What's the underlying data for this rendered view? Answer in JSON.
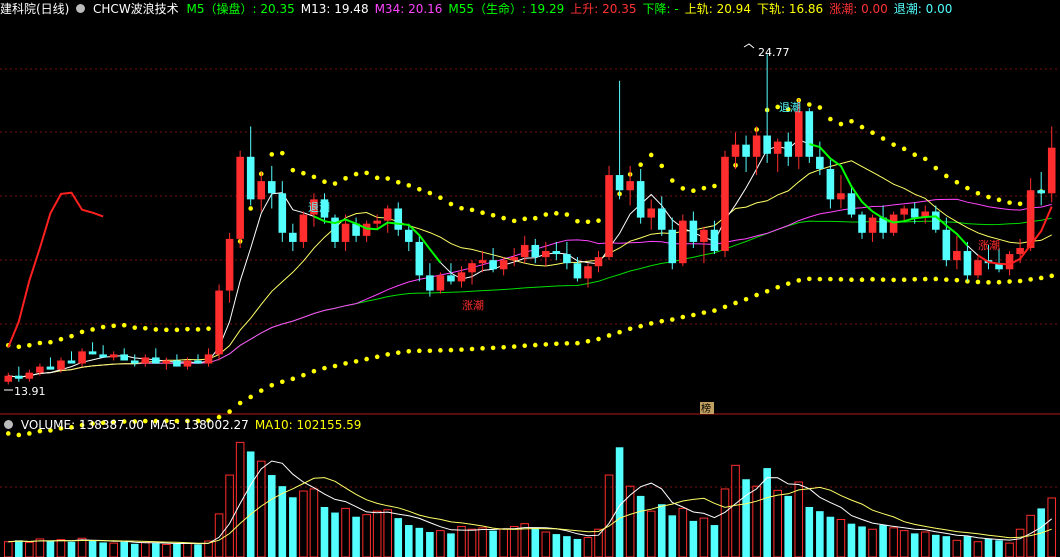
{
  "colors": {
    "up": "#ff2d2d",
    "down": "#54ffff",
    "green_line": "#00ff00",
    "ma5": "#ffffff",
    "ma13": "#ffff66",
    "ma34": "#ff44ff",
    "ma55": "#00dd00",
    "band": "#ffff00",
    "label": "#ffffff"
  },
  "header": {
    "title": "建科院(日线)",
    "indicator": "CHCW波浪技术",
    "items": [
      {
        "label": "M5（操盘）",
        "value": "20.35",
        "color": "#00ff00"
      },
      {
        "label": "M13",
        "value": "19.48",
        "color": "#ffffff"
      },
      {
        "label": "M34",
        "value": "20.16",
        "color": "#ff44ff"
      },
      {
        "label": "M55（生命）",
        "value": "19.29",
        "color": "#00ff00"
      },
      {
        "label": "上升",
        "value": "20.35",
        "color": "#ff3333"
      },
      {
        "label": "下降",
        "value": "-",
        "color": "#00ff00"
      },
      {
        "label": "上轨",
        "value": "20.94",
        "color": "#ffff00"
      },
      {
        "label": "下轨",
        "value": "16.86",
        "color": "#ffff00"
      },
      {
        "label": "涨潮",
        "value": "0.00",
        "color": "#ff3333"
      },
      {
        "label": "退潮",
        "value": "0.00",
        "color": "#54ffff"
      }
    ]
  },
  "volume_header": {
    "items": [
      {
        "label": "VOLUME",
        "value": "138387.00",
        "color": "#ffffff"
      },
      {
        "label": "MA5",
        "value": "138002.27",
        "color": "#ffffff"
      },
      {
        "label": "MA10",
        "value": "102155.59",
        "color": "#ffff00"
      }
    ]
  },
  "annotations": {
    "high_label": "24.77",
    "low_label": "13.91",
    "rise_label_1": "涨潮",
    "rise_label_2": "涨潮",
    "ebb_label_1": "退潮",
    "ebb_label_2": "退潮",
    "badge": "榜"
  },
  "chart_data": {
    "type": "candlestick",
    "price_range": [
      13.4,
      25.9
    ],
    "volume_range": [
      0,
      180000
    ],
    "candles": [
      [
        14.0,
        14.3,
        13.91,
        14.2
      ],
      [
        14.2,
        14.5,
        14.0,
        14.1
      ],
      [
        14.1,
        14.4,
        14.0,
        14.3
      ],
      [
        14.3,
        14.6,
        14.2,
        14.5
      ],
      [
        14.5,
        14.8,
        14.4,
        14.4
      ],
      [
        14.4,
        14.8,
        14.3,
        14.7
      ],
      [
        14.7,
        15.0,
        14.6,
        14.6
      ],
      [
        14.6,
        15.1,
        14.5,
        15.0
      ],
      [
        15.0,
        15.3,
        14.9,
        14.9
      ],
      [
        14.9,
        15.2,
        14.8,
        14.8
      ],
      [
        14.8,
        15.0,
        14.7,
        14.9
      ],
      [
        14.9,
        15.1,
        14.8,
        14.7
      ],
      [
        14.7,
        14.9,
        14.5,
        14.6
      ],
      [
        14.6,
        14.9,
        14.5,
        14.8
      ],
      [
        14.8,
        15.1,
        14.7,
        14.6
      ],
      [
        14.6,
        14.8,
        14.4,
        14.7
      ],
      [
        14.7,
        14.9,
        14.5,
        14.5
      ],
      [
        14.5,
        14.8,
        14.4,
        14.7
      ],
      [
        14.7,
        14.9,
        14.6,
        14.6
      ],
      [
        14.6,
        15.1,
        14.5,
        14.9
      ],
      [
        14.9,
        17.2,
        14.7,
        17.0
      ],
      [
        17.0,
        18.9,
        16.6,
        18.7
      ],
      [
        18.7,
        21.6,
        18.4,
        21.4
      ],
      [
        21.4,
        22.4,
        19.8,
        20.0
      ],
      [
        20.0,
        20.9,
        19.6,
        20.6
      ],
      [
        20.6,
        21.1,
        19.7,
        20.2
      ],
      [
        20.2,
        20.6,
        18.6,
        18.9
      ],
      [
        18.9,
        19.2,
        18.3,
        18.6
      ],
      [
        18.6,
        19.6,
        18.4,
        19.5
      ],
      [
        19.5,
        20.2,
        19.1,
        20.0
      ],
      [
        20.0,
        20.2,
        19.2,
        19.4
      ],
      [
        19.4,
        19.5,
        18.4,
        18.6
      ],
      [
        18.6,
        19.5,
        18.3,
        19.2
      ],
      [
        19.2,
        19.4,
        18.6,
        18.8
      ],
      [
        18.8,
        19.3,
        18.6,
        19.2
      ],
      [
        19.2,
        19.5,
        19.0,
        19.3
      ],
      [
        19.3,
        19.8,
        18.9,
        19.7
      ],
      [
        19.7,
        19.9,
        18.8,
        19.0
      ],
      [
        19.0,
        19.2,
        18.3,
        18.6
      ],
      [
        18.6,
        18.8,
        17.3,
        17.5
      ],
      [
        17.5,
        17.9,
        16.8,
        17.0
      ],
      [
        17.0,
        17.6,
        16.9,
        17.5
      ],
      [
        17.5,
        17.9,
        17.2,
        17.3
      ],
      [
        17.3,
        17.8,
        17.1,
        17.6
      ],
      [
        17.6,
        18.0,
        17.2,
        17.9
      ],
      [
        17.9,
        18.3,
        17.6,
        18.0
      ],
      [
        18.0,
        18.4,
        17.6,
        17.7
      ],
      [
        17.7,
        18.1,
        17.5,
        18.0
      ],
      [
        18.0,
        18.4,
        17.8,
        18.1
      ],
      [
        18.1,
        18.8,
        17.9,
        18.5
      ],
      [
        18.5,
        18.7,
        17.9,
        18.1
      ],
      [
        18.1,
        18.6,
        17.8,
        18.3
      ],
      [
        18.3,
        18.6,
        18.0,
        18.2
      ],
      [
        18.2,
        18.6,
        17.7,
        17.9
      ],
      [
        17.9,
        18.1,
        17.3,
        17.4
      ],
      [
        17.4,
        17.9,
        17.1,
        17.8
      ],
      [
        17.8,
        18.3,
        17.6,
        18.1
      ],
      [
        18.1,
        21.1,
        18.0,
        20.8
      ],
      [
        20.8,
        23.9,
        20.0,
        20.3
      ],
      [
        20.3,
        21.1,
        19.8,
        20.6
      ],
      [
        20.6,
        21.0,
        19.2,
        19.4
      ],
      [
        19.4,
        20.0,
        19.0,
        19.7
      ],
      [
        19.7,
        20.1,
        18.8,
        19.0
      ],
      [
        19.0,
        19.4,
        17.7,
        17.9
      ],
      [
        17.9,
        19.5,
        17.8,
        19.3
      ],
      [
        19.3,
        19.6,
        18.4,
        18.6
      ],
      [
        18.6,
        19.1,
        17.9,
        19.0
      ],
      [
        19.0,
        19.3,
        18.2,
        18.3
      ],
      [
        18.3,
        21.6,
        18.1,
        21.4
      ],
      [
        21.4,
        22.2,
        21.0,
        21.8
      ],
      [
        21.8,
        22.1,
        20.9,
        21.4
      ],
      [
        21.4,
        22.4,
        20.8,
        22.1
      ],
      [
        22.1,
        24.77,
        21.2,
        21.5
      ],
      [
        21.5,
        22.0,
        20.9,
        21.9
      ],
      [
        21.9,
        22.2,
        21.1,
        21.4
      ],
      [
        21.4,
        23.3,
        21.0,
        22.9
      ],
      [
        22.9,
        23.0,
        21.2,
        21.4
      ],
      [
        21.4,
        21.9,
        20.8,
        21.0
      ],
      [
        21.0,
        21.3,
        19.7,
        20.0
      ],
      [
        20.0,
        20.8,
        19.7,
        20.2
      ],
      [
        20.2,
        20.4,
        19.4,
        19.5
      ],
      [
        19.5,
        19.6,
        18.7,
        18.9
      ],
      [
        18.9,
        19.5,
        18.6,
        19.4
      ],
      [
        19.4,
        19.8,
        18.7,
        18.9
      ],
      [
        18.9,
        19.6,
        18.8,
        19.5
      ],
      [
        19.5,
        19.8,
        19.3,
        19.7
      ],
      [
        19.7,
        19.9,
        19.2,
        19.4
      ],
      [
        19.4,
        19.8,
        19.2,
        19.6
      ],
      [
        19.6,
        19.8,
        18.9,
        19.0
      ],
      [
        19.0,
        19.4,
        17.8,
        18.0
      ],
      [
        18.0,
        18.8,
        17.7,
        18.3
      ],
      [
        18.3,
        18.6,
        17.3,
        17.5
      ],
      [
        17.5,
        18.1,
        17.4,
        18.0
      ],
      [
        18.0,
        18.5,
        17.7,
        17.9
      ],
      [
        17.9,
        18.4,
        17.6,
        17.7
      ],
      [
        17.7,
        18.3,
        17.5,
        18.2
      ],
      [
        18.2,
        18.7,
        17.9,
        18.4
      ],
      [
        18.4,
        20.7,
        18.3,
        20.3
      ],
      [
        20.3,
        20.9,
        19.8,
        20.2
      ],
      [
        20.2,
        22.4,
        19.9,
        21.7
      ]
    ],
    "volumes": [
      22000,
      24000,
      21000,
      26000,
      23000,
      25000,
      22000,
      27000,
      24000,
      21000,
      20000,
      22000,
      19000,
      21000,
      20000,
      18000,
      19000,
      20000,
      18000,
      23000,
      62000,
      118000,
      165000,
      152000,
      138000,
      118000,
      102000,
      86000,
      95000,
      98000,
      72000,
      64000,
      70000,
      58000,
      61000,
      66000,
      68000,
      56000,
      46000,
      42000,
      36000,
      38000,
      34000,
      44000,
      40000,
      42000,
      38000,
      40000,
      44000,
      48000,
      42000,
      36000,
      33000,
      30000,
      26000,
      28000,
      40000,
      118000,
      158000,
      102000,
      88000,
      66000,
      76000,
      60000,
      70000,
      52000,
      56000,
      46000,
      98000,
      132000,
      112000,
      102000,
      128000,
      96000,
      88000,
      108000,
      72000,
      66000,
      58000,
      54000,
      48000,
      44000,
      40000,
      46000,
      42000,
      38000,
      34000,
      36000,
      32000,
      30000,
      24000,
      30000,
      22000,
      26000,
      24000,
      20000,
      40000,
      60000,
      70000,
      85000
    ]
  }
}
